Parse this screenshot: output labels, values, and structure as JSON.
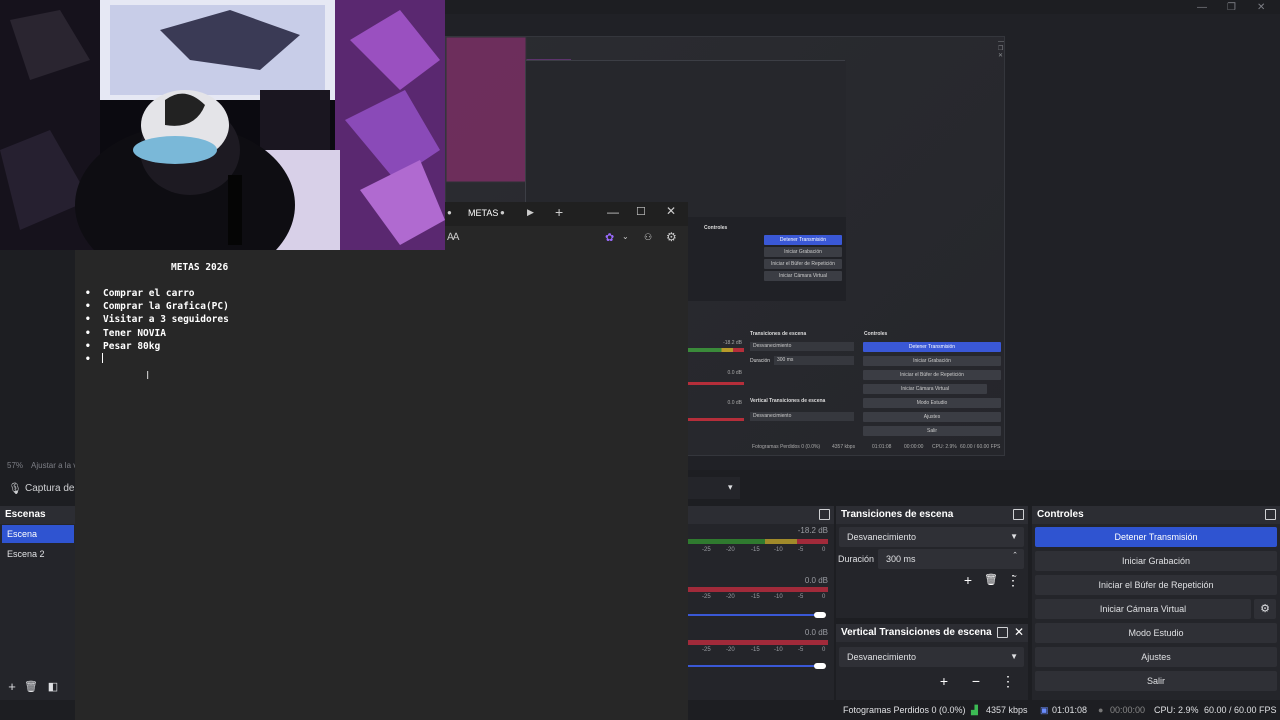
{
  "notepad": {
    "tab_label": "METAS",
    "title": "METAS 2026",
    "items": [
      "Comprar el carro",
      "Comprar la Grafica(PC)",
      "Visitar a 3 seguidores",
      "Tener NOVIA",
      "Pesar 80kg",
      ""
    ]
  },
  "preview": {
    "zoom": "57%",
    "zoom_label": "Ajustar a la v",
    "mic_source": "Captura de e"
  },
  "scenes": {
    "title": "Escenas",
    "items": [
      "Escena",
      "Escena 2"
    ]
  },
  "audio": {
    "meters": [
      {
        "db": "-18.2 dB"
      },
      {
        "db": "0.0 dB"
      },
      {
        "db": "0.0 dB"
      }
    ],
    "scale": [
      "-25",
      "-20",
      "-15",
      "-10",
      "-5",
      "0"
    ]
  },
  "transitions": {
    "title": "Transiciones de escena",
    "selected": "Desvanecimiento",
    "duration_label": "Duración",
    "duration_value": "300 ms"
  },
  "vertical_transitions": {
    "title": "Vertical Transiciones de escena",
    "selected": "Desvanecimiento"
  },
  "controls": {
    "title": "Controles",
    "buttons": [
      "Detener Transmisión",
      "Iniciar Grabación",
      "Iniciar el Búfer de Repetición",
      "Iniciar Cámara Virtual",
      "Modo Estudio",
      "Ajustes",
      "Salir"
    ]
  },
  "statusbar": {
    "dropped": "Fotogramas Perdidos 0 (0.0%)",
    "bitrate": "4357 kbps",
    "stream_time": "01:01:08",
    "rec_time": "00:00:00",
    "cpu": "CPU: 2.9%",
    "fps": "60.00 / 60.00 FPS"
  },
  "nested": {
    "controls": [
      "Detener Transmisión",
      "Iniciar Grabación",
      "Iniciar el Búfer de Repetición",
      "Iniciar Cámara Virtual",
      "Modo Estudio",
      "Ajustes",
      "Salir"
    ],
    "trans_title": "Transiciones de escena",
    "ctrl_title": "Controles",
    "vtrans_title": "Vertical Transiciones de escena",
    "selected": "Desvanecimiento",
    "duration_label": "Duración",
    "duration_value": "300 ms",
    "db1": "-18.2 dB",
    "db2": "0.0 dB",
    "db3": "0.0 dB",
    "status": "Fotogramas Perdidos 0 (0.0%)",
    "bitrate": "4357 kbps",
    "time": "01:01:08",
    "rec": "00:00:00",
    "cpu": "CPU: 2.9%",
    "fps": "60.00 / 60.00 FPS"
  },
  "colors": {
    "accent": "#2f54d1",
    "panel": "#24252a",
    "background": "#1d1e22"
  }
}
